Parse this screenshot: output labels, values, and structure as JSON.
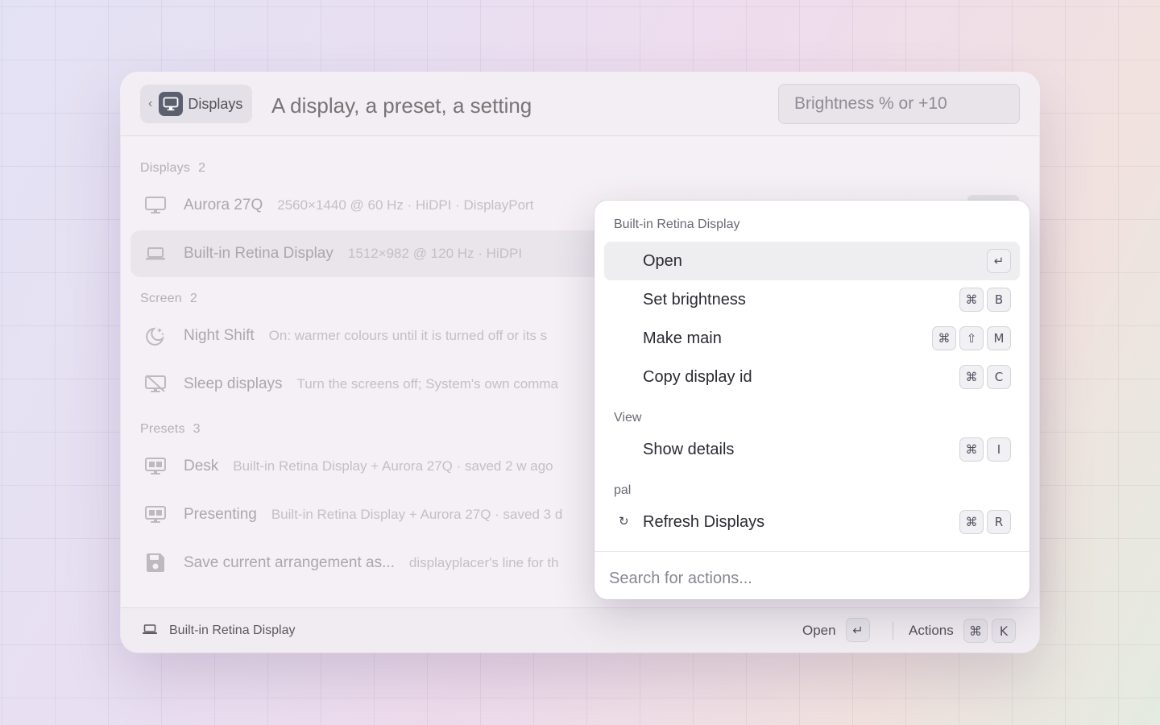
{
  "header": {
    "back_glyph": "‹",
    "breadcrumb_label": "Displays",
    "search_placeholder": "A display, a preset, a setting",
    "argument_placeholder": "Brightness % or +10"
  },
  "sections": [
    {
      "label": "Displays",
      "count": "2"
    },
    {
      "label": "Screen",
      "count": "2"
    },
    {
      "label": "Presets",
      "count": "3"
    }
  ],
  "rows": [
    {
      "title": "Aurora 27Q",
      "subtitle": "2560×1440 @ 60 Hz · HiDPI · DisplayPort",
      "icon": "monitor-icon"
    },
    {
      "title": "Built-in Retina Display",
      "subtitle": "1512×982 @ 120 Hz · HiDPI",
      "icon": "laptop-icon",
      "selected": true
    },
    {
      "title": "Night Shift",
      "subtitle": "On: warmer colours until it is turned off or its s",
      "icon": "moon-stars-icon"
    },
    {
      "title": "Sleep displays",
      "subtitle": "Turn the screens off; System's own comma",
      "icon": "display-off-icon"
    },
    {
      "title": "Desk",
      "subtitle": "Built-in Retina Display + Aurora 27Q · saved 2 w ago",
      "icon": "preset-icon"
    },
    {
      "title": "Presenting",
      "subtitle": "Built-in Retina Display + Aurora 27Q · saved 3 d",
      "icon": "preset-icon"
    },
    {
      "title": "Save current arrangement as...",
      "subtitle": "displayplacer's line for th",
      "icon": "save-icon"
    }
  ],
  "actions_panel": {
    "title": "Built-in Retina Display",
    "groups": [
      {
        "label": ""
      },
      {
        "label": "View"
      },
      {
        "label": "pal"
      }
    ],
    "actions": [
      {
        "label": "Open",
        "keys": [
          "↵"
        ],
        "selected": true
      },
      {
        "label": "Set brightness",
        "keys": [
          "⌘",
          "B"
        ]
      },
      {
        "label": "Make main",
        "keys": [
          "⌘",
          "⇧",
          "M"
        ]
      },
      {
        "label": "Copy display id",
        "keys": [
          "⌘",
          "C"
        ]
      },
      {
        "label": "Show details",
        "keys": [
          "⌘",
          "I"
        ]
      },
      {
        "label": "Refresh Displays",
        "keys": [
          "⌘",
          "R"
        ],
        "icon_glyph": "↻"
      }
    ],
    "search_placeholder": "Search for actions..."
  },
  "footer": {
    "selected_name": "Built-in Retina Display",
    "primary_label": "Open",
    "primary_key": "↵",
    "actions_label": "Actions",
    "actions_keys": [
      "⌘",
      "K"
    ]
  }
}
